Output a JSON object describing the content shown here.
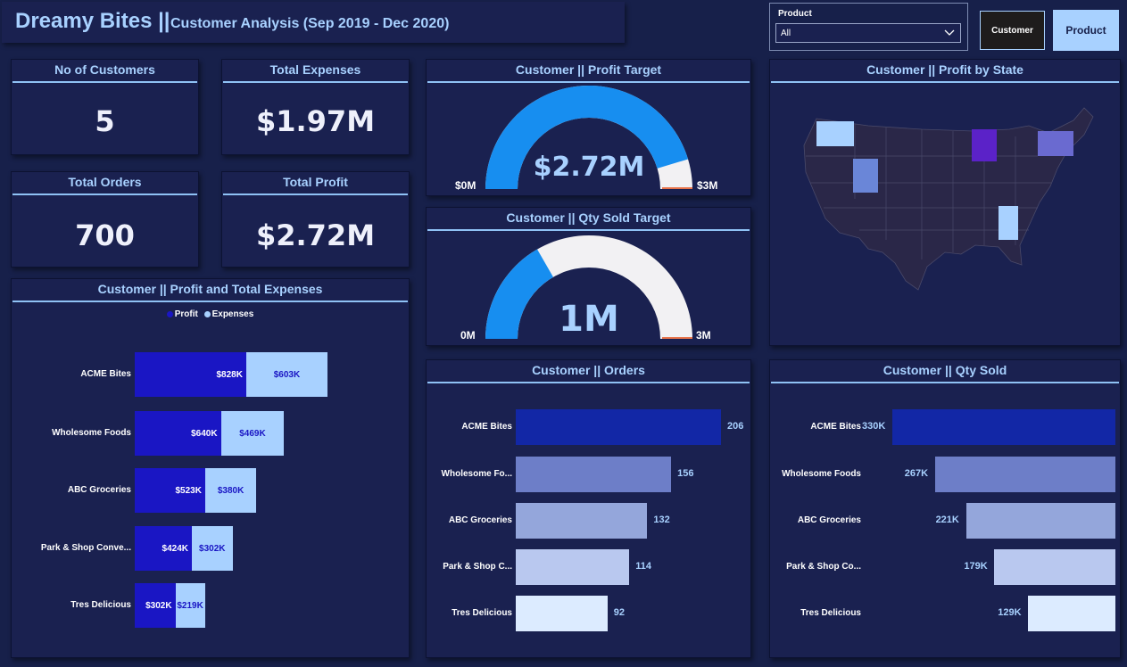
{
  "header": {
    "brand": "Dreamy Bites ||",
    "subtitle": "Customer Analysis (Sep 2019 - Dec 2020)"
  },
  "slicer": {
    "label": "Product",
    "value": "All",
    "icon": "chevron-down-icon"
  },
  "nav": {
    "customer_label": "Customer",
    "product_label": "Product",
    "customer_bg": "#1e1c1c",
    "product_bg": "#a8d1ff"
  },
  "kpis": {
    "customers": {
      "title": "No of Customers",
      "value": "5"
    },
    "expenses": {
      "title": "Total Expenses",
      "value": "$1.97M"
    },
    "orders": {
      "title": "Total Orders",
      "value": "700"
    },
    "profit": {
      "title": "Total Profit",
      "value": "$2.72M"
    }
  },
  "gauges": {
    "profit": {
      "title": "Customer || Profit Target",
      "value_label": "$2.72M",
      "min_label": "$0M",
      "max_label": "$3M",
      "value": 2.72,
      "min": 0,
      "max": 3
    },
    "qty": {
      "title": "Customer || Qty Sold Target",
      "value_label": "1M",
      "min_label": "0M",
      "max_label": "3M",
      "value": 1,
      "min": 0,
      "max": 3
    }
  },
  "map": {
    "title": "Customer || Profit by State",
    "highlighted_states": [
      "Washington",
      "Utah",
      "Wisconsin",
      "New York",
      "Alabama"
    ]
  },
  "colors": {
    "accent": "#a8d1ff",
    "profit": "#1a16c4",
    "expenses": "#a8d1ff",
    "gauge_fill": "#178ef0",
    "gauge_track": "#f2f1f3",
    "bar_shades": [
      "#1227a6",
      "#6d7ec8",
      "#94a6db",
      "#b9c8ef",
      "#dcebff"
    ]
  },
  "chart_data": [
    {
      "type": "bar",
      "orientation": "horizontal",
      "stacked": true,
      "title": "Customer || Profit and Total Expenses",
      "legend_position": "top-center",
      "categories": [
        "ACME Bites",
        "Wholesome Foods",
        "ABC Groceries",
        "Park & Shop Conve...",
        "Tres Delicious"
      ],
      "series": [
        {
          "name": "Profit",
          "values": [
            828,
            640,
            523,
            424,
            302
          ],
          "labels": [
            "$828K",
            "$640K",
            "$523K",
            "$424K",
            "$302K"
          ]
        },
        {
          "name": "Expenses",
          "values": [
            603,
            469,
            380,
            302,
            219
          ],
          "labels": [
            "$603K",
            "$469K",
            "$380K",
            "$302K",
            "$219K"
          ]
        }
      ],
      "units": "thousand USD",
      "grid": false
    },
    {
      "type": "bar",
      "orientation": "horizontal",
      "title": "Customer || Orders",
      "categories": [
        "ACME Bites",
        "Wholesome Fo...",
        "ABC Groceries",
        "Park & Shop C...",
        "Tres Delicious"
      ],
      "values": [
        206,
        156,
        132,
        114,
        92
      ],
      "labels": [
        "206",
        "156",
        "132",
        "114",
        "92"
      ],
      "grid": false
    },
    {
      "type": "bar",
      "orientation": "horizontal",
      "title": "Customer || Qty Sold",
      "categories": [
        "ACME Bites",
        "Wholesome Foods",
        "ABC Groceries",
        "Park & Shop Co...",
        "Tres Delicious"
      ],
      "values": [
        330,
        267,
        221,
        179,
        129
      ],
      "labels": [
        "330K",
        "267K",
        "221K",
        "179K",
        "129K"
      ],
      "units": "thousand",
      "grid": false
    }
  ]
}
